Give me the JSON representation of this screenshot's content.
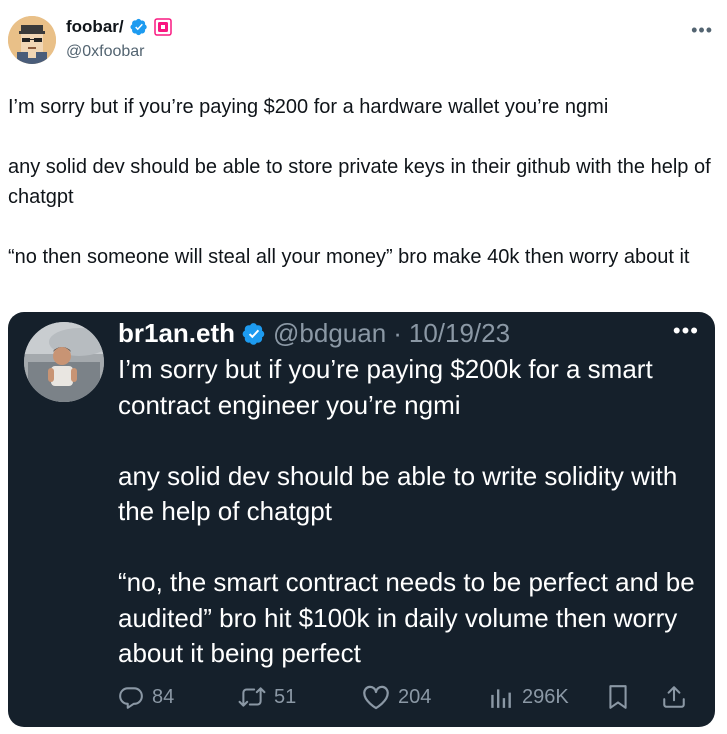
{
  "tweet": {
    "author": {
      "display_name": "foobar/",
      "handle": "@0xfoobar",
      "verified_badge_color": "#1d9bf0",
      "affiliate_badge_color": "#f91880",
      "avatar_icon": "pixel-art-avatar-icon"
    },
    "more_icon": "more-icon",
    "text": "I’m sorry but if you’re paying $200 for a hardware wallet you’re ngmi\n\nany solid dev should be able to store private keys in their github with the help of chatgpt\n\n“no then someone will steal all your money” bro make 40k then worry about it"
  },
  "quote": {
    "author": {
      "display_name": "br1an.eth",
      "handle": "@bdguan",
      "separator": "·",
      "date": "10/19/23",
      "verified_badge_color": "#1d9bf0",
      "avatar_icon": "photo-avatar-icon"
    },
    "more_icon": "more-icon",
    "text": "I’m sorry but if you’re paying $200k for a smart contract engineer you’re ngmi\n\nany solid dev should be able to write solidity with the help of chatgpt\n\n“no, the smart contract needs to be perfect and be audited” bro hit $100k in daily volume then worry about it being perfect",
    "background_color": "#15202b",
    "actions": {
      "replies": "84",
      "reposts": "51",
      "likes": "204",
      "views": "296K"
    }
  }
}
